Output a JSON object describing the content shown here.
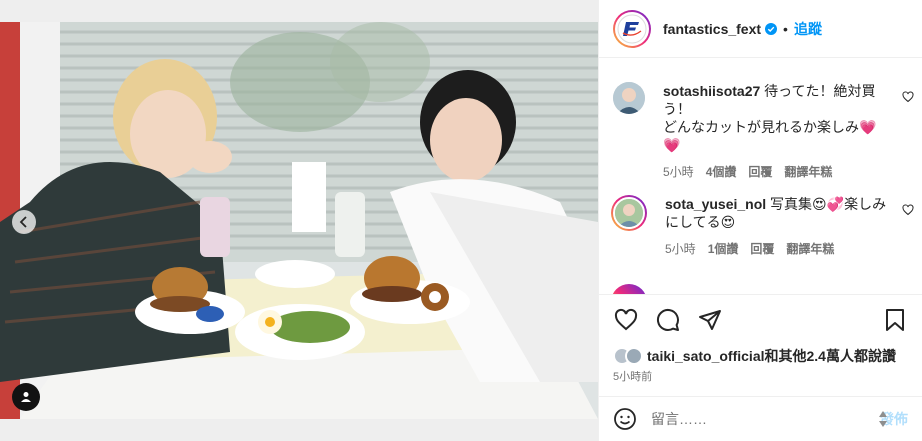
{
  "post": {
    "username": "fantastics_fext",
    "verified": true,
    "separator": "•",
    "follow_label": "追蹤",
    "avatar_text": "FANTASTICS",
    "photo_alt": "two men sitting at a diner table with burgers and milkshakes"
  },
  "comments": [
    {
      "username": "sotashiisota27",
      "text": "待ってた！絶対買う！\nどんなカットが見れるか楽しみ💗💗",
      "time": "5小時",
      "likes": "4個讚",
      "reply": "回覆",
      "translate": "翻譯年糕"
    },
    {
      "username": "sota_yusei_nol",
      "text": "写真集😍💞楽しみにしてる😍",
      "time": "5小時",
      "likes": "1個讚",
      "reply": "回覆",
      "translate": "翻譯年糕"
    }
  ],
  "likes_line": {
    "user": "taiki_sato_official",
    "suffix": "和其他2.4萬人都說讚"
  },
  "timestamp": "5小時前",
  "comment_box": {
    "placeholder": "留言……",
    "post_label": "發佈"
  },
  "icons": {
    "prev": "chevron-left-icon",
    "tag": "user-tag-icon",
    "like": "heart-icon",
    "comment": "comment-icon",
    "share": "paper-plane-icon",
    "save": "bookmark-icon",
    "emoji": "smiley-icon",
    "verified": "verified-badge-icon"
  },
  "colors": {
    "accent": "#0095f6",
    "post_disabled": "#b2dffc",
    "verified": "#0095f6"
  }
}
